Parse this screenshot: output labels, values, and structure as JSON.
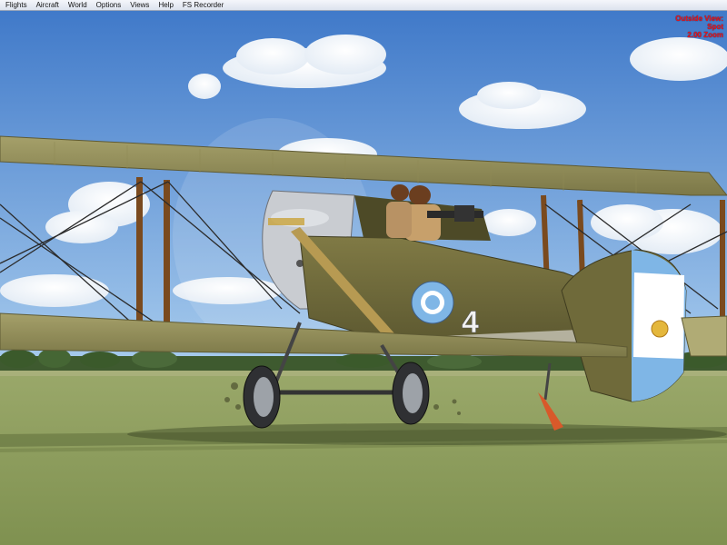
{
  "menu": {
    "items": [
      {
        "key": "flights",
        "label": "Flights"
      },
      {
        "key": "aircraft",
        "label": "Aircraft"
      },
      {
        "key": "world",
        "label": "World"
      },
      {
        "key": "options",
        "label": "Options"
      },
      {
        "key": "views",
        "label": "Views"
      },
      {
        "key": "help",
        "label": "Help"
      },
      {
        "key": "fs_recorder",
        "label": "FS Recorder"
      }
    ]
  },
  "view_info": {
    "mode": "Outside View:",
    "type": "Spot",
    "zoom": "2.00 Zoom"
  },
  "aircraft": {
    "fuselage_number": "4",
    "roundel_colors": {
      "outer": "#7fb6e6",
      "inner": "#ffffff"
    },
    "livery_color": "#6f6a3a"
  },
  "colors": {
    "sky_top": "#3d77c8",
    "sky_bottom": "#9cc4ea",
    "grass": "#8a9b5a",
    "hud_text": "#e8141e"
  }
}
